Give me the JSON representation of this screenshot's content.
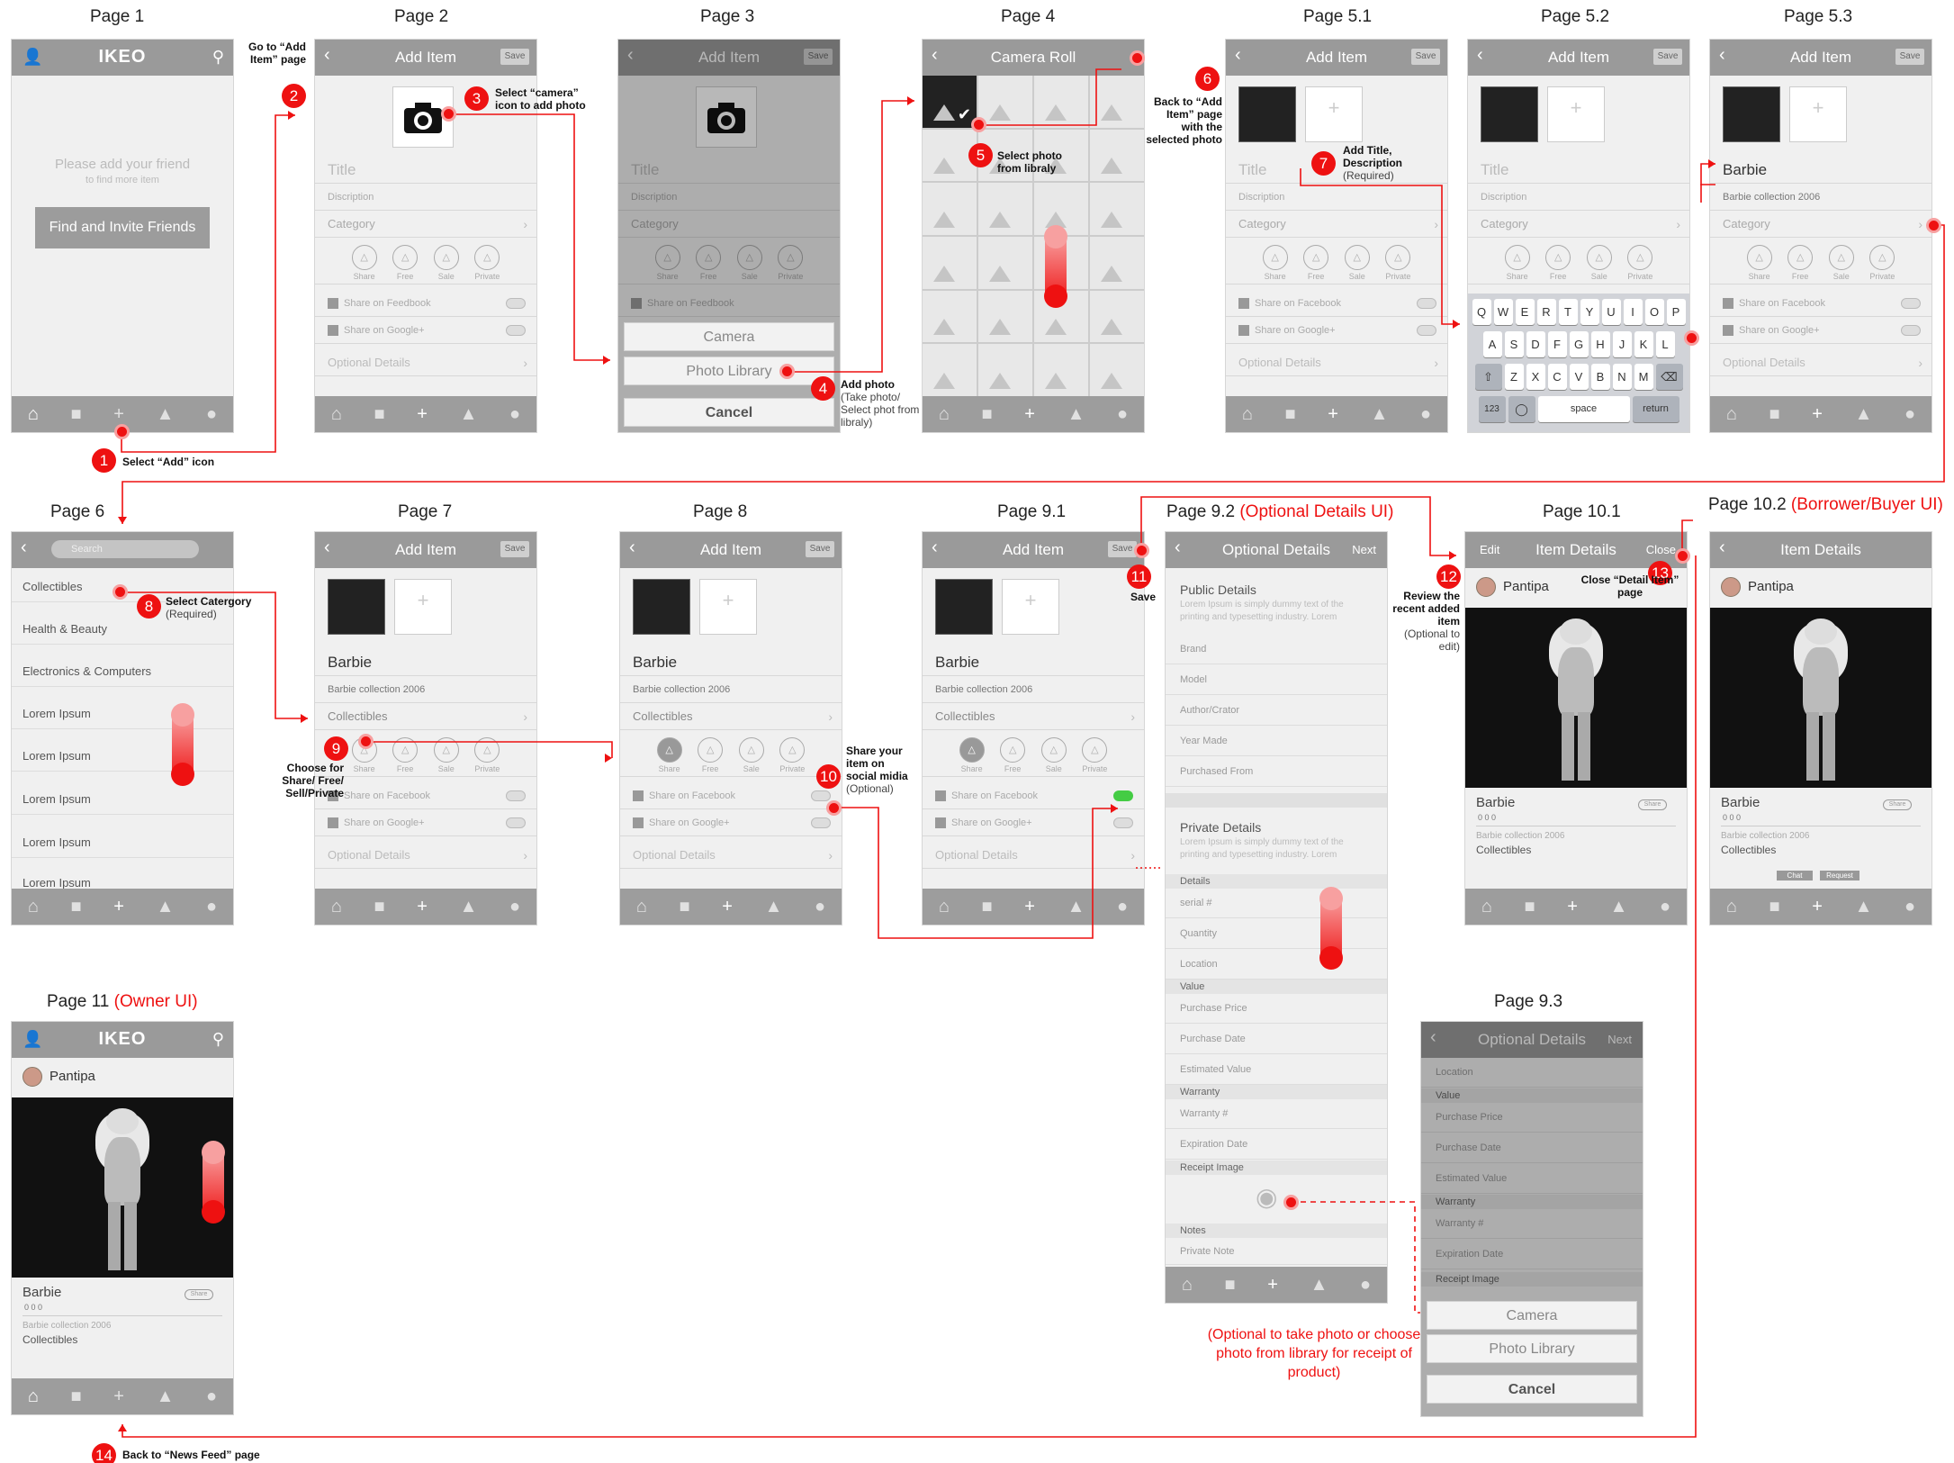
{
  "page_titles": {
    "p1": "Page 1",
    "p2": "Page 2",
    "p3": "Page 3",
    "p4": "Page 4",
    "p51": "Page 5.1",
    "p52": "Page 5.2",
    "p53": "Page 5.3",
    "p6": "Page 6",
    "p7": "Page 7",
    "p8": "Page 8",
    "p91": "Page 9.1",
    "p92": "Page 9.2",
    "p92_note": "(Optional Details UI)",
    "p101": "Page 10.1",
    "p102": "Page 10.2",
    "p102_note": "(Borrower/Buyer UI)",
    "p11": "Page 11",
    "p11_note": "(Owner UI)",
    "p93": "Page 9.3"
  },
  "common": {
    "app_name": "IKEO",
    "add_item": "Add Item",
    "save": "Save",
    "title_ph": "Title",
    "description_ph": "Discription",
    "category_ph": "Category",
    "share": "Share",
    "free": "Free",
    "sale": "Sale",
    "private": "Private",
    "share_facebook": "Share on Feedbook",
    "share_facebook2": "Share on Facebook",
    "share_google": "Share on Google+",
    "optional_details": "Optional Details",
    "item_title": "Barbie",
    "item_desc": "Barbie collection 2006",
    "item_cat": "Collectibles",
    "camera": "Camera",
    "photo_library": "Photo Library",
    "cancel": "Cancel",
    "camera_roll": "Camera Roll",
    "next": "Next",
    "item_details": "Item Details",
    "edit": "Edit",
    "close": "Close",
    "user": "Pantipa",
    "share_pill": "Share",
    "chat": "Chat",
    "request": "Request",
    "counts": "0   0   0"
  },
  "page1": {
    "empty_line1": "Please add your friend",
    "empty_line2": "to find more item",
    "invite_button": "Find and Invite Friends"
  },
  "keyboard": {
    "row1": [
      "Q",
      "W",
      "E",
      "R",
      "T",
      "Y",
      "U",
      "I",
      "O",
      "P"
    ],
    "row2": [
      "A",
      "S",
      "D",
      "F",
      "G",
      "H",
      "J",
      "K",
      "L"
    ],
    "row3": [
      "Z",
      "X",
      "C",
      "V",
      "B",
      "N",
      "M"
    ],
    "num": "123",
    "space": "space",
    "ret": "return"
  },
  "page6": {
    "search": "Search",
    "categories": [
      "Collectibles",
      "Health & Beauty",
      "Electronics & Computers",
      "Lorem Ipsum",
      "Lorem Ipsum",
      "Lorem Ipsum",
      "Lorem Ipsum",
      "Lorem Ipsum"
    ]
  },
  "optional": {
    "public_details": "Public Details",
    "lorem": "Lorem Ipsum is simply dummy text of the printing and typesetting industry. Lorem",
    "brand": "Brand",
    "model": "Model",
    "author": "Author/Crator",
    "year": "Year Made",
    "purchased_from": "Purchased From",
    "private_details": "Private Details",
    "details": "Details",
    "serial": "serial #",
    "quantity": "Quantity",
    "location": "Location",
    "value": "Value",
    "purchase_price": "Purchase Price",
    "purchase_date": "Purchase Date",
    "estimated_value": "Estimated Value",
    "warranty": "Warranty",
    "warranty_no": "Warranty #",
    "expiration": "Expiration Date",
    "receipt": "Receipt Image",
    "notes": "Notes",
    "private_note": "Private Note"
  },
  "annotations": {
    "a1": "Select “Add” icon",
    "a2": "Go to “Add Item” page",
    "a3": "Select “camera” icon to add photo",
    "a4_main": "Add photo",
    "a4_sub": "(Take photo/ Select phot from libraly)",
    "a5": "Select photo from libraly",
    "a6": "Back to “Add Item” page with the selected photo",
    "a7_main": "Add Title, Description",
    "a7_sub": "(Required)",
    "a8_main": "Select Catergory",
    "a8_sub": "(Required)",
    "a9": "Choose for Share/ Free/ Sell/Private",
    "a10_main": "Share your item on social midia",
    "a10_sub": "(Optional)",
    "a11": "Save",
    "a12_main": "Review the recent added item",
    "a12_sub": "(Optional to edit)",
    "a13": "Close “Detail Item” page",
    "a14": "Back to “News Feed” page",
    "receipt_note": "(Optional to take photo or choose photo from library for receipt of product)"
  },
  "badges": [
    "1",
    "2",
    "3",
    "4",
    "5",
    "6",
    "7",
    "8",
    "9",
    "10",
    "11",
    "12",
    "13",
    "14"
  ],
  "colors": {
    "accent": "#e11111",
    "nav": "#9a9a9a",
    "screen_bg": "#f0f0f0"
  }
}
